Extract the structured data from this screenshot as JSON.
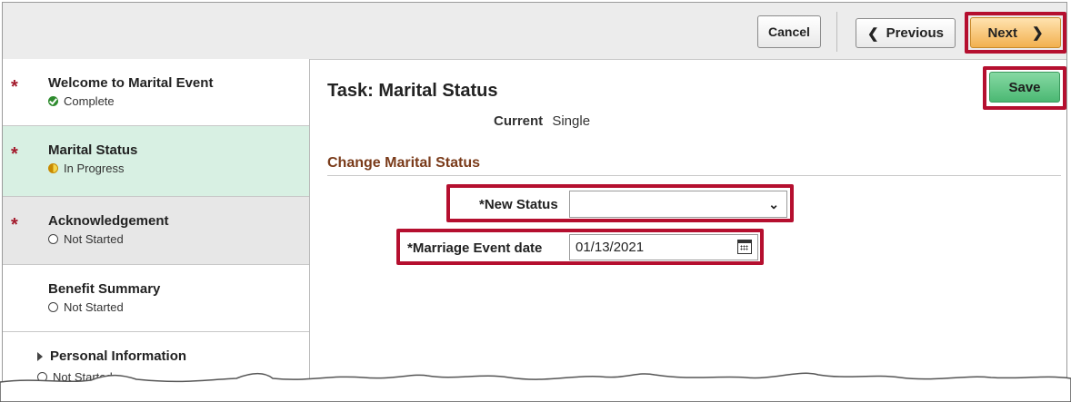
{
  "toolbar": {
    "cancel_label": "Cancel",
    "previous_label": "Previous",
    "next_label": "Next"
  },
  "sidebar": {
    "items": [
      {
        "label": "Welcome to Marital Event",
        "status": "Complete",
        "required": "*"
      },
      {
        "label": "Marital Status",
        "status": "In Progress",
        "required": "*"
      },
      {
        "label": "Acknowledgement",
        "status": "Not Started",
        "required": "*"
      },
      {
        "label": "Benefit Summary",
        "status": "Not Started"
      },
      {
        "label": "Personal Information",
        "status": "Not Started"
      }
    ]
  },
  "main": {
    "task_title": "Task: Marital Status",
    "save_label": "Save",
    "current_label": "Current",
    "current_value": "Single",
    "section_title": "Change Marital Status",
    "new_status_label": "*New Status",
    "new_status_value": "",
    "marriage_date_label": "*Marriage Event date",
    "marriage_date_value": "01/13/2021"
  },
  "colors": {
    "highlight": "#b50f2f",
    "active_step_bg": "#d8f0e3",
    "save_button": "#4bb873",
    "next_button": "#f2b04f",
    "section_title": "#7a3b1a"
  }
}
